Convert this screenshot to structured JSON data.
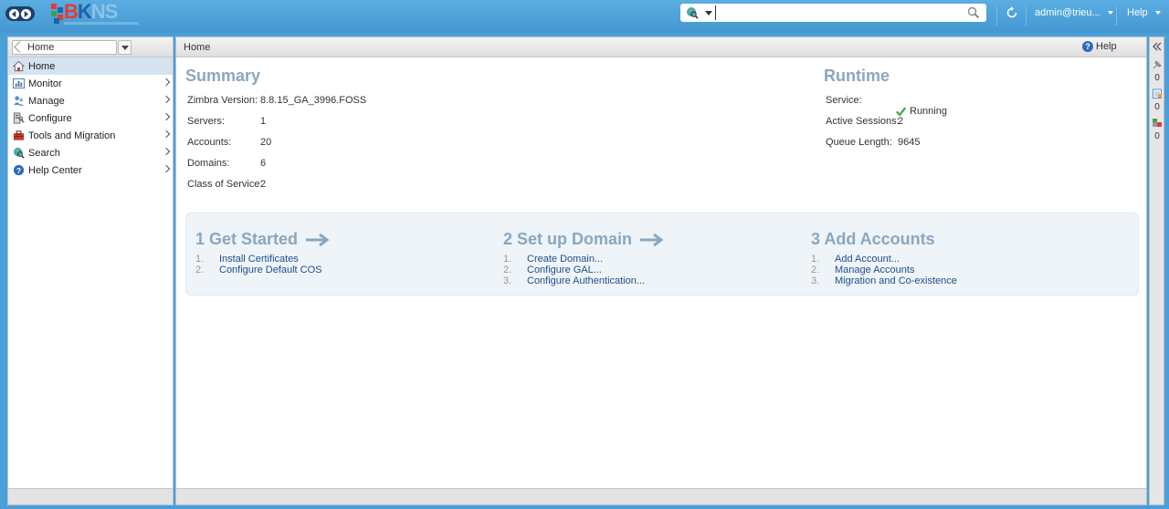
{
  "topbar": {
    "logo_text": [
      "B",
      "K",
      "NS"
    ],
    "search": {
      "value": "",
      "placeholder": ""
    },
    "user_label": "admin@trieu...",
    "help_label": "Help"
  },
  "left": {
    "breadcrumb": "Home",
    "items": [
      {
        "label": "Home",
        "icon": "home-icon",
        "selected": true
      },
      {
        "label": "Monitor",
        "icon": "chart-icon"
      },
      {
        "label": "Manage",
        "icon": "users-icon"
      },
      {
        "label": "Configure",
        "icon": "configure-icon"
      },
      {
        "label": "Tools and Migration",
        "icon": "toolbox-icon"
      },
      {
        "label": "Search",
        "icon": "search-globe-icon"
      },
      {
        "label": "Help Center",
        "icon": "help-icon"
      }
    ]
  },
  "main": {
    "header_title": "Home",
    "help_label": "Help",
    "summary": {
      "title": "Summary",
      "rows": [
        {
          "label": "Zimbra Version:",
          "value": "8.8.15_GA_3996.FOSS"
        },
        {
          "label": "Servers:",
          "value": "1"
        },
        {
          "label": "Accounts:",
          "value": "20"
        },
        {
          "label": "Domains:",
          "value": "6"
        },
        {
          "label": "Class of Service:",
          "value": "2"
        }
      ]
    },
    "runtime": {
      "title": "Runtime",
      "rows": [
        {
          "label": "Service:",
          "value": "Running"
        },
        {
          "label": "Active Sessions:",
          "value": "2"
        },
        {
          "label": "Queue Length:",
          "value": "9645"
        }
      ]
    },
    "steps": [
      {
        "title": "1 Get Started",
        "items": [
          "Install Certificates",
          "Configure Default COS"
        ]
      },
      {
        "title": "2 Set up Domain",
        "items": [
          "Create Domain...",
          "Configure GAL...",
          "Configure Authentication..."
        ]
      },
      {
        "title": "3 Add Accounts",
        "items": [
          "Add Account...",
          "Manage Accounts",
          "Migration and Co-existence"
        ]
      }
    ]
  },
  "rightstrip": {
    "counts": [
      "0",
      "0",
      "0"
    ]
  },
  "colors": {
    "topbar": "#4a9fd8",
    "section_title": "#8aa7bf",
    "link": "#1f4e8c",
    "selected": "#d5e3f1"
  }
}
